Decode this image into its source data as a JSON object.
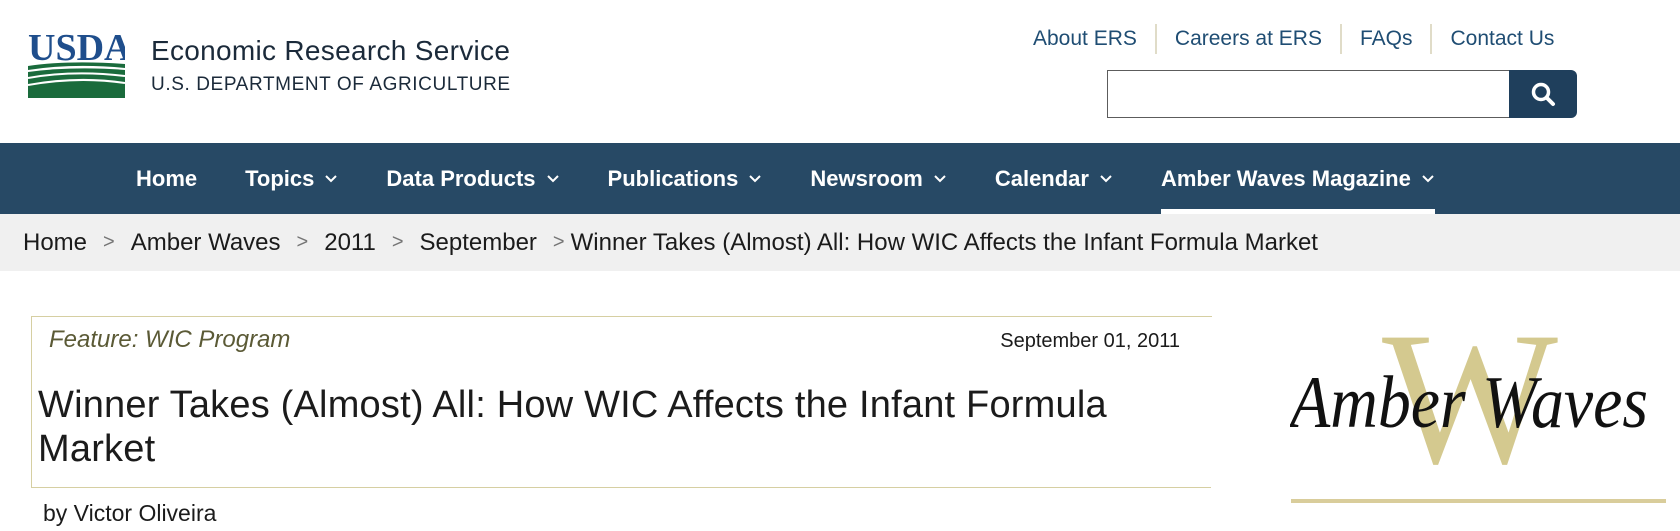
{
  "header": {
    "logo_text": "USDA",
    "agency_name": "Economic Research Service",
    "department": "U.S. DEPARTMENT OF AGRICULTURE",
    "utility_links": [
      "About ERS",
      "Careers at ERS",
      "FAQs",
      "Contact Us"
    ],
    "search": {
      "placeholder": "",
      "value": "",
      "button_icon": "search-icon"
    }
  },
  "nav": {
    "items": [
      {
        "label": "Home",
        "has_dropdown": false,
        "active": false
      },
      {
        "label": "Topics",
        "has_dropdown": true,
        "active": false
      },
      {
        "label": "Data Products",
        "has_dropdown": true,
        "active": false
      },
      {
        "label": "Publications",
        "has_dropdown": true,
        "active": false
      },
      {
        "label": "Newsroom",
        "has_dropdown": true,
        "active": false
      },
      {
        "label": "Calendar",
        "has_dropdown": true,
        "active": false
      },
      {
        "label": "Amber Waves Magazine",
        "has_dropdown": true,
        "active": true
      }
    ]
  },
  "breadcrumb": {
    "items": [
      "Home",
      "Amber Waves",
      "2011",
      "September"
    ],
    "current": "Winner Takes (Almost) All: How WIC Affects the Infant Formula Market"
  },
  "article": {
    "feature": "Feature: WIC Program",
    "date": "September 01, 2011",
    "title": "Winner Takes (Almost) All: How WIC Affects the Infant Formula Market",
    "byline": "by Victor Oliveira"
  },
  "sidebar": {
    "logo_text": "Amber Waves"
  },
  "colors": {
    "nav_bg": "#274965",
    "link": "#1f4d73",
    "usda_blue": "#1f4e8c",
    "usda_green": "#1a6b3c",
    "gold_rule": "#d6cfa2",
    "amber_w": "#d4c98f"
  }
}
